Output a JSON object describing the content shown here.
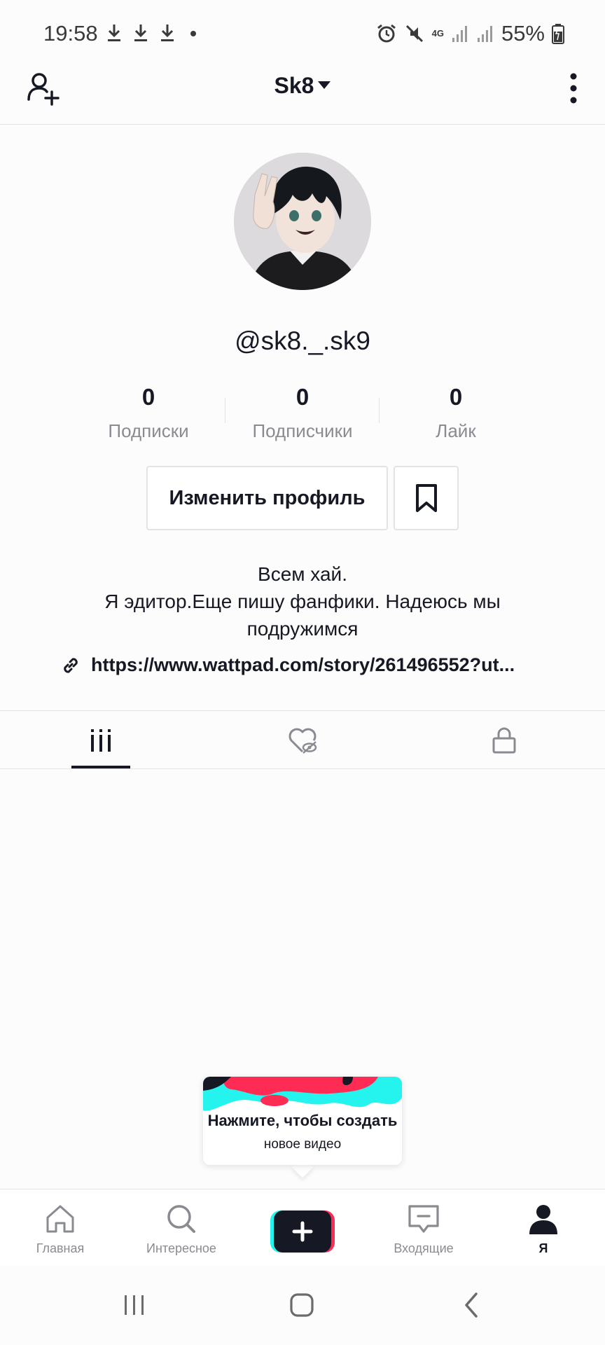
{
  "status_bar": {
    "time": "19:58",
    "battery": "55%",
    "network": "4G",
    "icons": [
      "download-icon",
      "download-icon",
      "download-icon",
      "alarm-icon",
      "mute-icon",
      "signal-icon",
      "signal-icon",
      "battery-icon"
    ]
  },
  "header": {
    "title": "Sk8",
    "add_user_icon": "add-user-icon",
    "more_icon": "more-vertical-icon"
  },
  "profile": {
    "username": "@sk8._.sk9",
    "stats": [
      {
        "value": "0",
        "label": "Подписки"
      },
      {
        "value": "0",
        "label": "Подписчики"
      },
      {
        "value": "0",
        "label": "Лайк"
      }
    ],
    "edit_button": "Изменить профиль",
    "bio_lines": [
      "Всем хай.",
      "Я эдитор.Еще пишу фанфики. Надеюсь мы",
      "подружимся"
    ],
    "link": "https://www.wattpad.com/story/261496552?ut..."
  },
  "tabs": [
    {
      "name": "videos",
      "icon": "grid-icon",
      "active": true
    },
    {
      "name": "liked",
      "icon": "hidden-heart-icon",
      "active": false
    },
    {
      "name": "private",
      "icon": "lock-icon",
      "active": false
    }
  ],
  "tooltip": {
    "title": "Нажмите, чтобы создать",
    "subtitle": "новое видео"
  },
  "bottom_nav": [
    {
      "label": "Главная",
      "icon": "home-icon",
      "active": false
    },
    {
      "label": "Интересное",
      "icon": "search-icon",
      "active": false
    },
    {
      "label": "",
      "icon": "create-plus-icon",
      "active": false
    },
    {
      "label": "Входящие",
      "icon": "inbox-icon",
      "active": false
    },
    {
      "label": "Я",
      "icon": "profile-icon",
      "active": true
    }
  ],
  "colors": {
    "text": "#161823",
    "secondary": "#8a8b91",
    "border": "#e3e3e4",
    "accent_cyan": "#25f4ee",
    "accent_red": "#fe2c55"
  }
}
